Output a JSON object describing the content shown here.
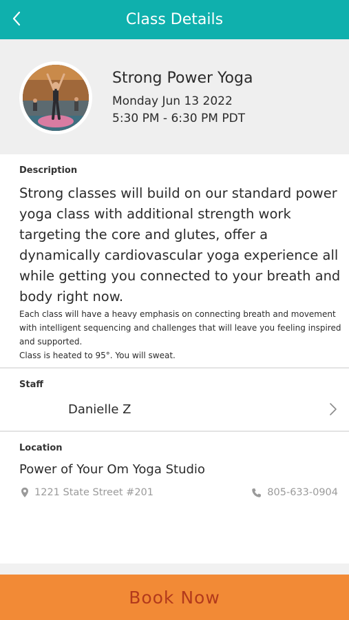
{
  "header": {
    "title": "Class Details",
    "back_icon": "chevron-left-icon"
  },
  "colors": {
    "header_bg": "#0fb0ad",
    "card_bg": "#efefef",
    "book_bg": "#f28a36",
    "book_text": "#b23a1c",
    "muted_text": "#9a9a9a"
  },
  "class": {
    "name": "Strong Power Yoga",
    "date": "Monday Jun 13 2022",
    "time": "5:30 PM - 6:30 PM PDT"
  },
  "description": {
    "label": "Description",
    "main": "Strong classes will build on our standard power yoga class with additional strength work targeting the core and glutes, offer a dynamically cardiovascular yoga experience all while getting you connected to your breath and body right now.",
    "sub_lines": [
      "Each class will have a heavy emphasis on connecting breath and movement with intelligent sequencing and challenges that will leave you feeling inspired and supported.",
      "Class is heated to 95°. You will sweat."
    ]
  },
  "staff": {
    "label": "Staff",
    "name": "Danielle Z",
    "chevron_icon": "chevron-right-icon"
  },
  "location": {
    "label": "Location",
    "name": "Power of Your Om Yoga Studio",
    "address": "1221 State Street #201",
    "phone": "805-633-0904",
    "address_icon": "map-pin-icon",
    "phone_icon": "phone-icon"
  },
  "actions": {
    "book_label": "Book Now"
  }
}
